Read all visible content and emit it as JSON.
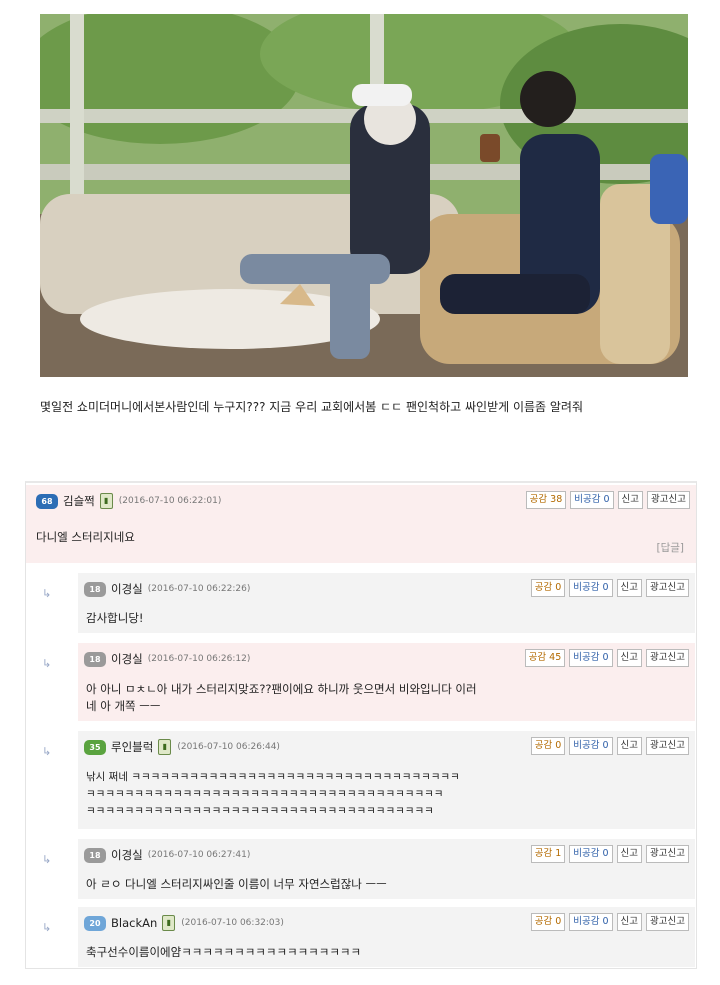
{
  "caption": "몇일전 쇼미더머니에서본사람인데 누구지??? 지금 우리 교회에서봄 ㄷㄷ 팬인척하고 싸인받게 이름좀 알려줘",
  "buttons": {
    "report": "신고",
    "ad_report": "광고신고"
  },
  "comments": [
    {
      "level": "68",
      "author": "김슬쩍",
      "date": "(2016-07-10 06:22:01)",
      "like": "공감 38",
      "dislike": "비공감 0",
      "lines": [
        "다니엘 스터리지네요"
      ],
      "reply_link": "[답글]"
    },
    {
      "level": "18",
      "author": "이경실",
      "date": "(2016-07-10 06:22:26)",
      "like": "공감 0",
      "dislike": "비공감 0",
      "lines": [
        "감사합니당!"
      ]
    },
    {
      "level": "18",
      "author": "이경실",
      "date": "(2016-07-10 06:26:12)",
      "like": "공감 45",
      "dislike": "비공감 0",
      "lines": [
        "아 아니 ㅁㅊㄴ아 내가 스터리지맞죠??팬이에요 하니까 웃으면서 비와입니다 이러",
        "네 아 개쪽 ㅡㅡ"
      ]
    },
    {
      "level": "35",
      "author": "루인블럭",
      "date": "(2016-07-10 06:26:44)",
      "like": "공감 0",
      "dislike": "비공감 0",
      "lines": [
        "낚시 쩌네 ㅋㅋㅋㅋㅋㅋㅋㅋㅋㅋㅋㅋㅋㅋㅋㅋㅋㅋㅋㅋㅋㅋㅋㅋㅋㅋㅋㅋㅋㅋㅋㅋㅋㅋ",
        "ㅋㅋㅋㅋㅋㅋㅋㅋㅋㅋㅋㅋㅋㅋㅋㅋㅋㅋㅋㅋㅋㅋㅋㅋㅋㅋㅋㅋㅋㅋㅋㅋㅋㅋㅋㅋㅋ",
        "ㅋㅋㅋㅋㅋㅋㅋㅋㅋㅋㅋㅋㅋㅋㅋㅋㅋㅋㅋㅋㅋㅋㅋㅋㅋㅋㅋㅋㅋㅋㅋㅋㅋㅋㅋㅋ"
      ]
    },
    {
      "level": "18",
      "author": "이경실",
      "date": "(2016-07-10 06:27:41)",
      "like": "공감 1",
      "dislike": "비공감 0",
      "lines": [
        "아 ㄹㅇ 다니엘 스터리지싸인줄 이름이 너무 자연스럽잖나 ㅡㅡ"
      ]
    },
    {
      "level": "20",
      "author": "BlackAn",
      "date": "(2016-07-10 06:32:03)",
      "like": "공감 0",
      "dislike": "비공감 0",
      "lines": [
        "축구선수이름이에얌ㅋㅋㅋㅋㅋㅋㅋㅋㅋㅋㅋㅋㅋㅋㅋㅋㅋ"
      ]
    }
  ],
  "reply_arrow": "↳"
}
